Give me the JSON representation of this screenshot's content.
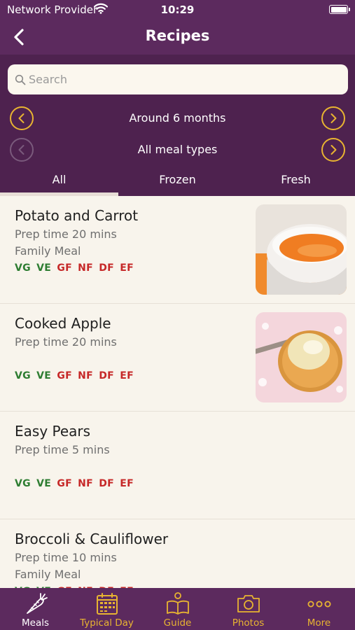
{
  "status_bar": {
    "carrier": "Network Provider",
    "time": "10:29"
  },
  "nav": {
    "title": "Recipes",
    "back_icon": "chevron-left-icon"
  },
  "search": {
    "placeholder": "Search"
  },
  "filters": {
    "age": "Around 6 months",
    "meal_type": "All meal types"
  },
  "tabs": [
    {
      "label": "All",
      "selected": true
    },
    {
      "label": "Frozen",
      "selected": false
    },
    {
      "label": "Fresh",
      "selected": false
    }
  ],
  "colors": {
    "brand": "#5c2a5e",
    "accent": "#e8b431",
    "background": "#f8f4ec",
    "tag_green": "#2e7d32",
    "tag_red": "#c62828"
  },
  "recipes": [
    {
      "title": "Potato and Carrot",
      "prep": "Prep time 20 mins",
      "family": "Family Meal",
      "tags": [
        "VG",
        "VE",
        "GF",
        "NF",
        "DF",
        "EF"
      ]
    },
    {
      "title": "Cooked Apple",
      "prep": "Prep time 20 mins",
      "family": "",
      "tags": [
        "VG",
        "VE",
        "GF",
        "NF",
        "DF",
        "EF"
      ]
    },
    {
      "title": "Easy Pears",
      "prep": "Prep time 5 mins",
      "family": "",
      "tags": [
        "VG",
        "VE",
        "GF",
        "NF",
        "DF",
        "EF"
      ]
    },
    {
      "title": "Broccoli & Cauliflower",
      "prep": "Prep time 10 mins",
      "family": "Family Meal",
      "tags": [
        "VG",
        "VE",
        "GF",
        "NF",
        "DF",
        "EF"
      ]
    }
  ],
  "tab_bar": [
    {
      "label": "Meals",
      "icon": "carrot-icon",
      "active": true
    },
    {
      "label": "Typical Day",
      "icon": "calendar-icon",
      "active": false
    },
    {
      "label": "Guide",
      "icon": "book-reader-icon",
      "active": false
    },
    {
      "label": "Photos",
      "icon": "camera-icon",
      "active": false
    },
    {
      "label": "More",
      "icon": "more-dots-icon",
      "active": false
    }
  ]
}
